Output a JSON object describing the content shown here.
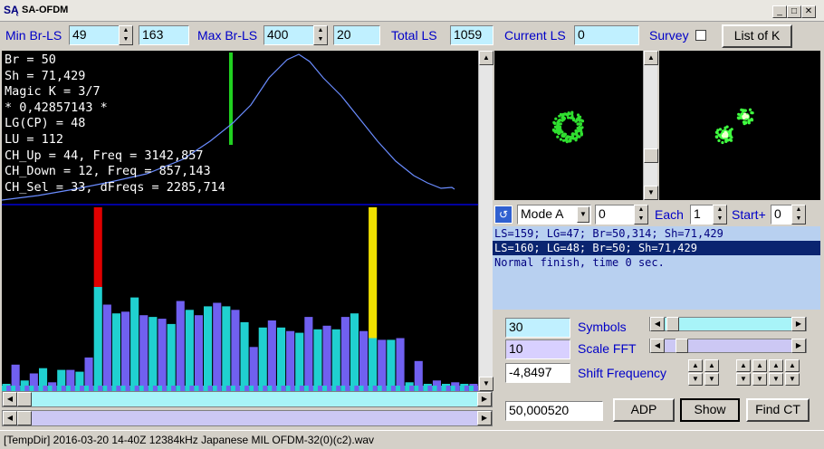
{
  "window": {
    "title": "SA-OFDM",
    "icon_text": "SĄ"
  },
  "toolbar": {
    "min_label": "Min Br-LS",
    "min_value": "49",
    "min_extra": "163",
    "max_label": "Max Br-LS",
    "max_value": "400",
    "max_extra": "20",
    "total_label": "Total LS",
    "total_value": "1059",
    "current_label": "Current LS",
    "current_value": "0",
    "survey_label": "Survey",
    "listk_label": "List of K"
  },
  "params": [
    "Br = 50",
    "Sh = 71,429",
    "Magic K = 3/7",
    "* 0,42857143 *",
    "LG(CP) = 48",
    "LU = 112",
    "CH_Up = 44, Freq = 3142,857",
    "CH_Down = 12, Freq = 857,143",
    "CH_Sel = 33, dFreqs = 2285,714"
  ],
  "mode": {
    "mode_value": "Mode A",
    "mode_num": "0",
    "each_label": "Each",
    "each_value": "1",
    "start_label": "Start+",
    "start_value": "0"
  },
  "log": [
    "LS=159; LG=47; Br=50,314; Sh=71,429",
    "LS=160; LG=48; Br=50; Sh=71,429",
    "Normal finish, time 0 sec."
  ],
  "controls": {
    "symbols_value": "30",
    "symbols_label": "Symbols",
    "scale_value": "10",
    "scale_label": "Scale FFT",
    "shift_value": "-4,8497",
    "shift_label": "Shift Frequency",
    "freq_value": "50,000520",
    "adp_label": "ADP",
    "show_label": "Show",
    "findct_label": "Find CT"
  },
  "status": {
    "text": "[TempDir] 2016-03-20 14-40Z 12384kHz Japanese MIL OFDM-32(0)(c2).wav"
  },
  "colors": {
    "bar_cyan": "#20d0d0",
    "bar_violet": "#7060f0",
    "marker_red": "#e00000",
    "marker_yellow": "#f0e000",
    "marker_green": "#20d020",
    "curve": "#6a8cff"
  },
  "chart_data": {
    "type": "bar",
    "bars": [
      {
        "top": 0.04,
        "color": "cyan"
      },
      {
        "top": 0.15,
        "color": "violet"
      },
      {
        "top": 0.06,
        "color": "cyan"
      },
      {
        "top": 0.1,
        "color": "violet"
      },
      {
        "top": 0.13,
        "color": "cyan"
      },
      {
        "top": 0.05,
        "color": "violet"
      },
      {
        "top": 0.12,
        "color": "cyan"
      },
      {
        "top": 0.12,
        "color": "violet"
      },
      {
        "top": 0.11,
        "color": "cyan"
      },
      {
        "top": 0.19,
        "color": "violet"
      },
      {
        "top": 0.59,
        "color": "cyan"
      },
      {
        "top": 0.49,
        "color": "violet"
      },
      {
        "top": 0.44,
        "color": "cyan"
      },
      {
        "top": 0.45,
        "color": "violet"
      },
      {
        "top": 0.53,
        "color": "cyan"
      },
      {
        "top": 0.43,
        "color": "violet"
      },
      {
        "top": 0.42,
        "color": "cyan"
      },
      {
        "top": 0.41,
        "color": "violet"
      },
      {
        "top": 0.38,
        "color": "cyan"
      },
      {
        "top": 0.51,
        "color": "violet"
      },
      {
        "top": 0.46,
        "color": "cyan"
      },
      {
        "top": 0.43,
        "color": "violet"
      },
      {
        "top": 0.48,
        "color": "cyan"
      },
      {
        "top": 0.5,
        "color": "violet"
      },
      {
        "top": 0.48,
        "color": "cyan"
      },
      {
        "top": 0.46,
        "color": "violet"
      },
      {
        "top": 0.39,
        "color": "cyan"
      },
      {
        "top": 0.25,
        "color": "violet"
      },
      {
        "top": 0.36,
        "color": "cyan"
      },
      {
        "top": 0.4,
        "color": "violet"
      },
      {
        "top": 0.36,
        "color": "cyan"
      },
      {
        "top": 0.34,
        "color": "violet"
      },
      {
        "top": 0.33,
        "color": "cyan"
      },
      {
        "top": 0.42,
        "color": "violet"
      },
      {
        "top": 0.35,
        "color": "cyan"
      },
      {
        "top": 0.37,
        "color": "violet"
      },
      {
        "top": 0.35,
        "color": "cyan"
      },
      {
        "top": 0.42,
        "color": "violet"
      },
      {
        "top": 0.44,
        "color": "cyan"
      },
      {
        "top": 0.34,
        "color": "violet"
      },
      {
        "top": 0.3,
        "color": "cyan"
      },
      {
        "top": 0.29,
        "color": "violet"
      },
      {
        "top": 0.29,
        "color": "cyan"
      },
      {
        "top": 0.3,
        "color": "violet"
      },
      {
        "top": 0.05,
        "color": "cyan"
      },
      {
        "top": 0.17,
        "color": "violet"
      },
      {
        "top": 0.03,
        "color": "cyan"
      },
      {
        "top": 0.06,
        "color": "violet"
      },
      {
        "top": 0.03,
        "color": "cyan"
      },
      {
        "top": 0.05,
        "color": "violet"
      },
      {
        "top": 0.02,
        "color": "cyan"
      },
      {
        "top": 0.04,
        "color": "violet"
      }
    ],
    "markers": [
      {
        "index": 10,
        "color": "red"
      },
      {
        "index": 40,
        "color": "yellow"
      }
    ]
  }
}
